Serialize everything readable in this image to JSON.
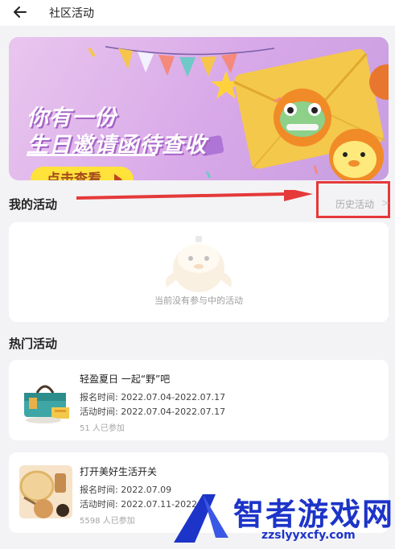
{
  "header": {
    "title": "社区活动"
  },
  "banner": {
    "line1": "你有一份",
    "line2": "生日邀请函待查收",
    "cta_label": "点击查看"
  },
  "my_activity": {
    "section_title": "我的活动",
    "history_label": "历史活动",
    "history_chevron": ">",
    "empty_text": "当前没有参与中的活动"
  },
  "hot": {
    "section_title": "热门活动",
    "items": [
      {
        "name": "轻盈夏日 一起“野”吧",
        "signup": "报名时间: 2022.07.04-2022.07.17",
        "period": "活动时间: 2022.07.04-2022.07.17",
        "participants": "51 人已参加"
      },
      {
        "name": "打开美好生活开关",
        "signup": "报名时间: 2022.07.09",
        "period": "活动时间: 2022.07.11-2022.07",
        "participants": "5598 人已参加"
      }
    ]
  },
  "watermark": {
    "text": "智者游戏网",
    "url": "zzslyyxcfy.com"
  },
  "colors": {
    "accent_red": "#e5393a",
    "cta_yellow": "#ffe23a",
    "watermark_blue": "#1d34c9"
  },
  "icons": [
    "back-arrow-icon",
    "chevron-right-icon",
    "cta-arrow-icon"
  ]
}
